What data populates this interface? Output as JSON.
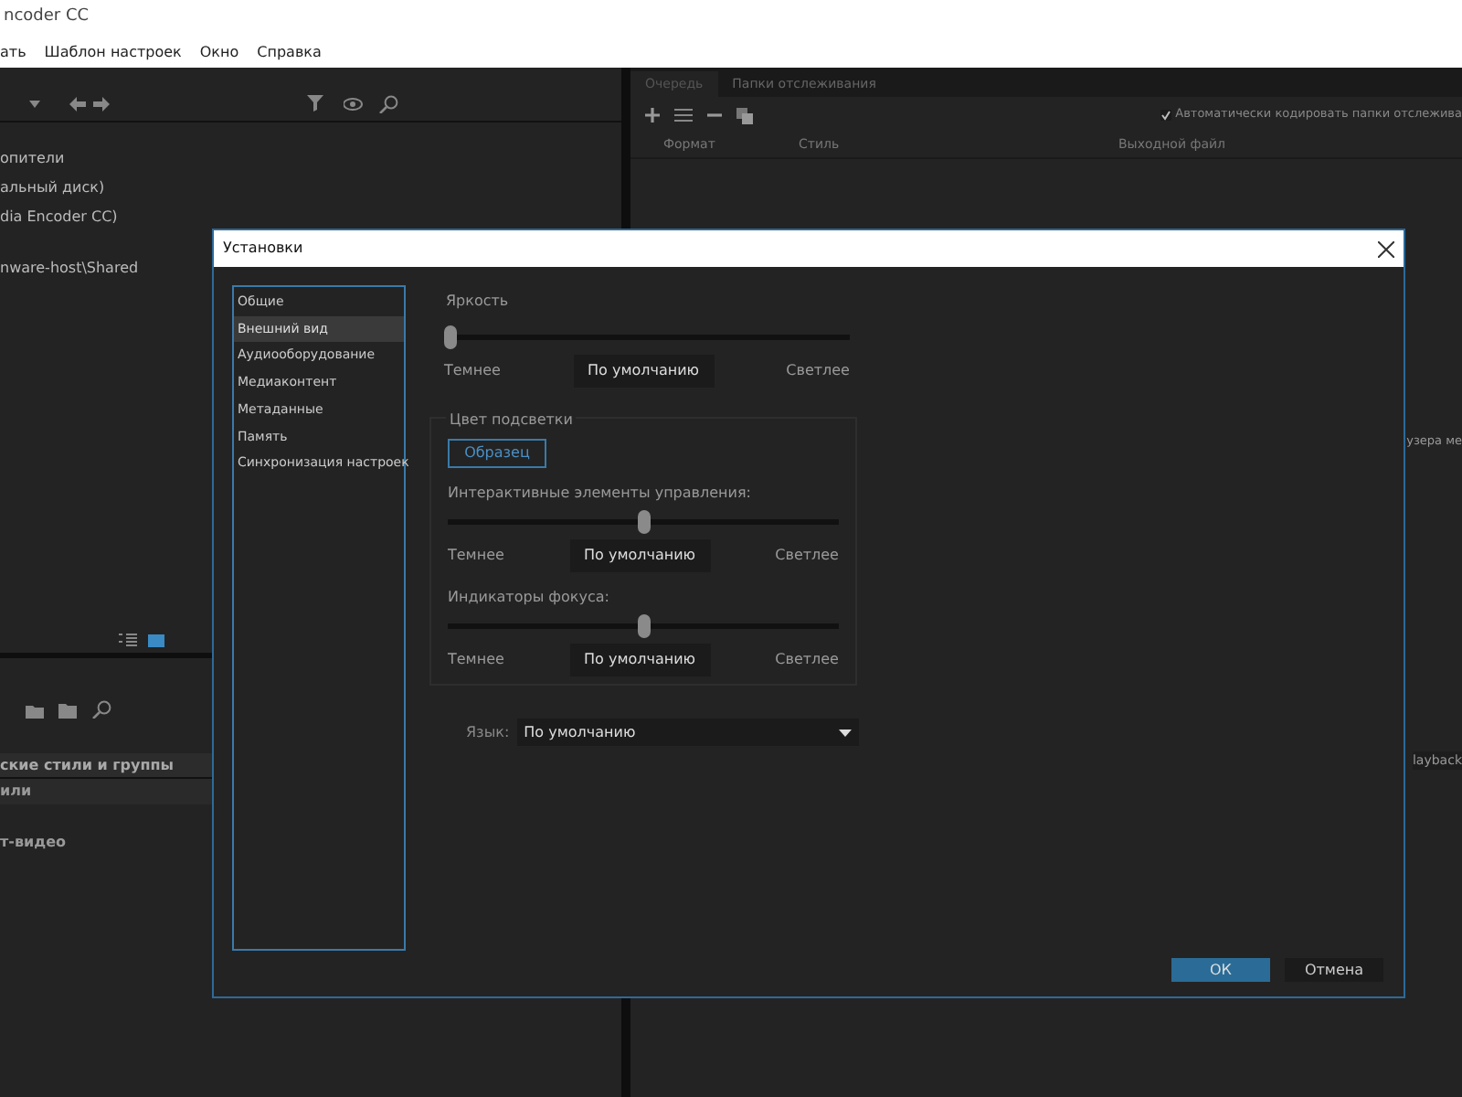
{
  "app_window": {
    "title": "ncoder CC",
    "menu": [
      "ать",
      "Шаблон настроек",
      "Окно",
      "Справка"
    ]
  },
  "media_browser": {
    "tree_items": [
      "опители",
      "альный диск)",
      "dia Encoder CC)",
      "nware-host\\Shared"
    ]
  },
  "preset_browser": {
    "column_header": "ские стили и группы",
    "rows": [
      "или",
      "т-видео"
    ]
  },
  "queue_panel": {
    "tabs": [
      {
        "label": "Очередь",
        "selected": true
      },
      {
        "label": "Папки отслеживания",
        "selected": false
      }
    ],
    "auto_encode": {
      "label": "Автоматически кодировать папки отслежива",
      "checked": true
    },
    "columns": [
      "Формат",
      "Стиль",
      "Выходной файл"
    ],
    "fragments": [
      "узера ме",
      "layback"
    ]
  },
  "dialog": {
    "title": "Установки",
    "categories": [
      {
        "label": "Общие",
        "selected": false
      },
      {
        "label": "Внешний вид",
        "selected": true
      },
      {
        "label": "Аудиооборудование",
        "selected": false
      },
      {
        "label": "Медиаконтент",
        "selected": false
      },
      {
        "label": "Метаданные",
        "selected": false
      },
      {
        "label": "Память",
        "selected": false
      },
      {
        "label": "Синхронизация настроек",
        "selected": false
      }
    ],
    "brightness": {
      "label": "Яркость",
      "level": 0,
      "left": "Темнее",
      "default_button": "По умолчанию",
      "right": "Светлее"
    },
    "highlight": {
      "title": "Цвет подсветки",
      "sample_button": "Образец",
      "sliders": [
        {
          "label": "Интерактивные элементы управления:",
          "level": 0.5,
          "left": "Темнее",
          "default_button": "По умолчанию",
          "right": "Светлее"
        },
        {
          "label": "Индикаторы фокуса:",
          "level": 0.5,
          "left": "Темнее",
          "default_button": "По умолчанию",
          "right": "Светлее"
        }
      ]
    },
    "language": {
      "label": "Язык:",
      "value": "По умолчанию"
    },
    "ok": "ОК",
    "cancel": "Отмена"
  }
}
